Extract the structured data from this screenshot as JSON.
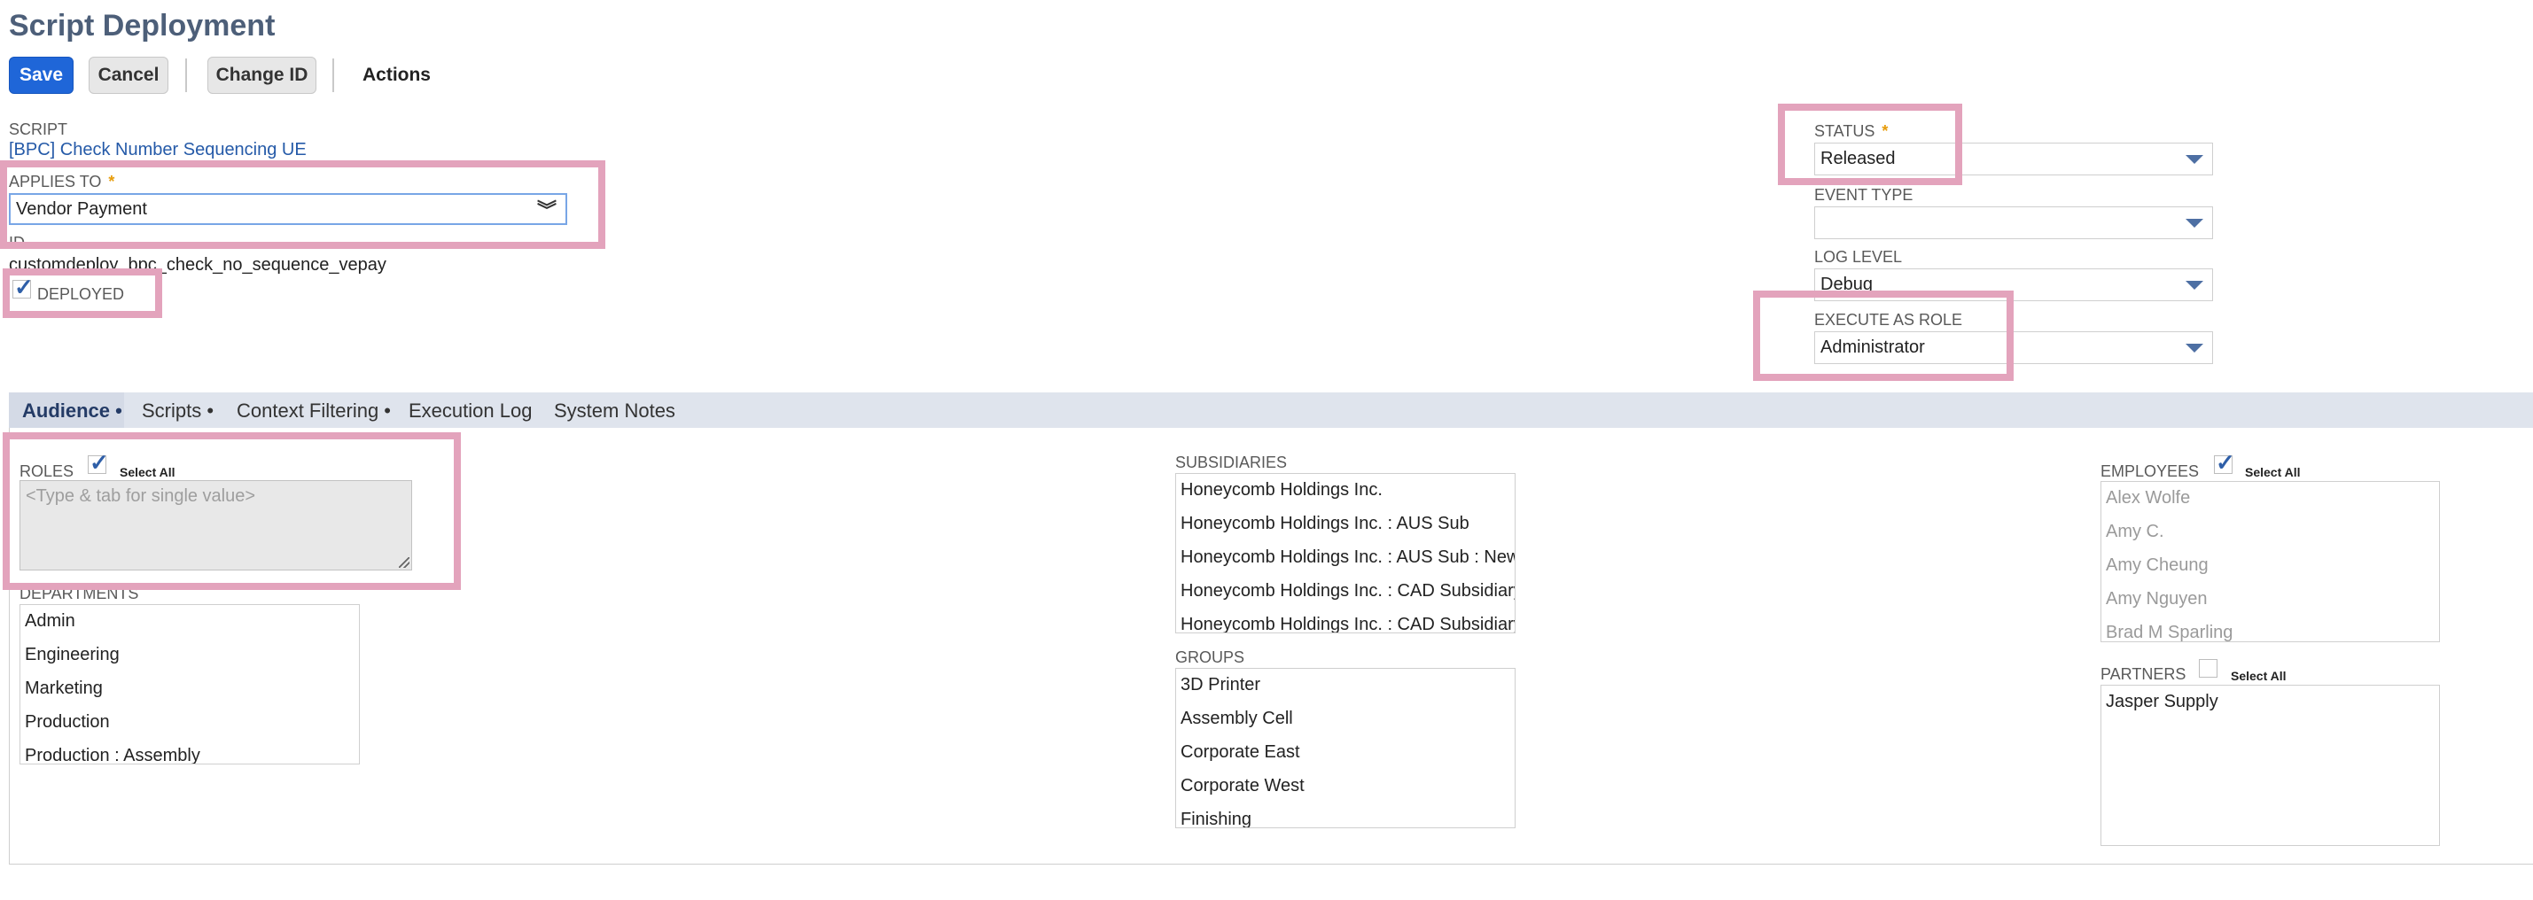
{
  "page_title": "Script Deployment",
  "toolbar": {
    "save_label": "Save",
    "cancel_label": "Cancel",
    "change_id_label": "Change ID",
    "actions_label": "Actions"
  },
  "fields": {
    "script_label": "SCRIPT",
    "script_value": "[BPC] Check Number Sequencing UE",
    "applies_to_label": "APPLIES TO",
    "applies_to_value": "Vendor Payment",
    "id_label": "ID",
    "id_value": "customdeploy_bpc_check_no_sequence_vepay",
    "deployed_label": "DEPLOYED",
    "status_label": "STATUS",
    "status_value": "Released",
    "event_type_label": "EVENT TYPE",
    "event_type_value": "",
    "log_level_label": "LOG LEVEL",
    "log_level_value": "Debug",
    "execute_as_role_label": "EXECUTE AS ROLE",
    "execute_as_role_value": "Administrator",
    "required_marker": "*"
  },
  "tabs": [
    {
      "label": "Audience •",
      "active": true
    },
    {
      "label": "Scripts •",
      "active": false
    },
    {
      "label": "Context Filtering •",
      "active": false
    },
    {
      "label": "Execution Log",
      "active": false
    },
    {
      "label": "System Notes",
      "active": false
    }
  ],
  "audience": {
    "roles_label": "ROLES",
    "select_all_label": "Select All",
    "roles_placeholder": "<Type & tab for single value>",
    "departments_label": "DEPARTMENTS",
    "departments": [
      "Admin",
      "Engineering",
      "Marketing",
      "Production",
      "Production : Assembly"
    ],
    "subsidiaries_label": "SUBSIDIARIES",
    "subsidiaries": [
      "Honeycomb Holdings Inc.",
      "Honeycomb Holdings Inc. : AUS Sub",
      "Honeycomb Holdings Inc. : AUS Sub : New",
      "Honeycomb Holdings Inc. : CAD Subsidiary",
      "Honeycomb Holdings Inc. : CAD Subsidiary"
    ],
    "groups_label": "GROUPS",
    "groups": [
      "3D Printer",
      "Assembly Cell",
      "Corporate East",
      "Corporate West",
      "Finishing"
    ],
    "employees_label": "EMPLOYEES",
    "employees": [
      "Alex Wolfe",
      "Amy C.",
      "Amy Cheung",
      "Amy Nguyen",
      "Brad M Sparling"
    ],
    "partners_label": "PARTNERS",
    "partners": [
      "Jasper Supply"
    ]
  },
  "colors": {
    "highlight": "#e3a3bc",
    "primary_button": "#1f66d8",
    "title": "#4d5f79",
    "link": "#255aa8"
  }
}
